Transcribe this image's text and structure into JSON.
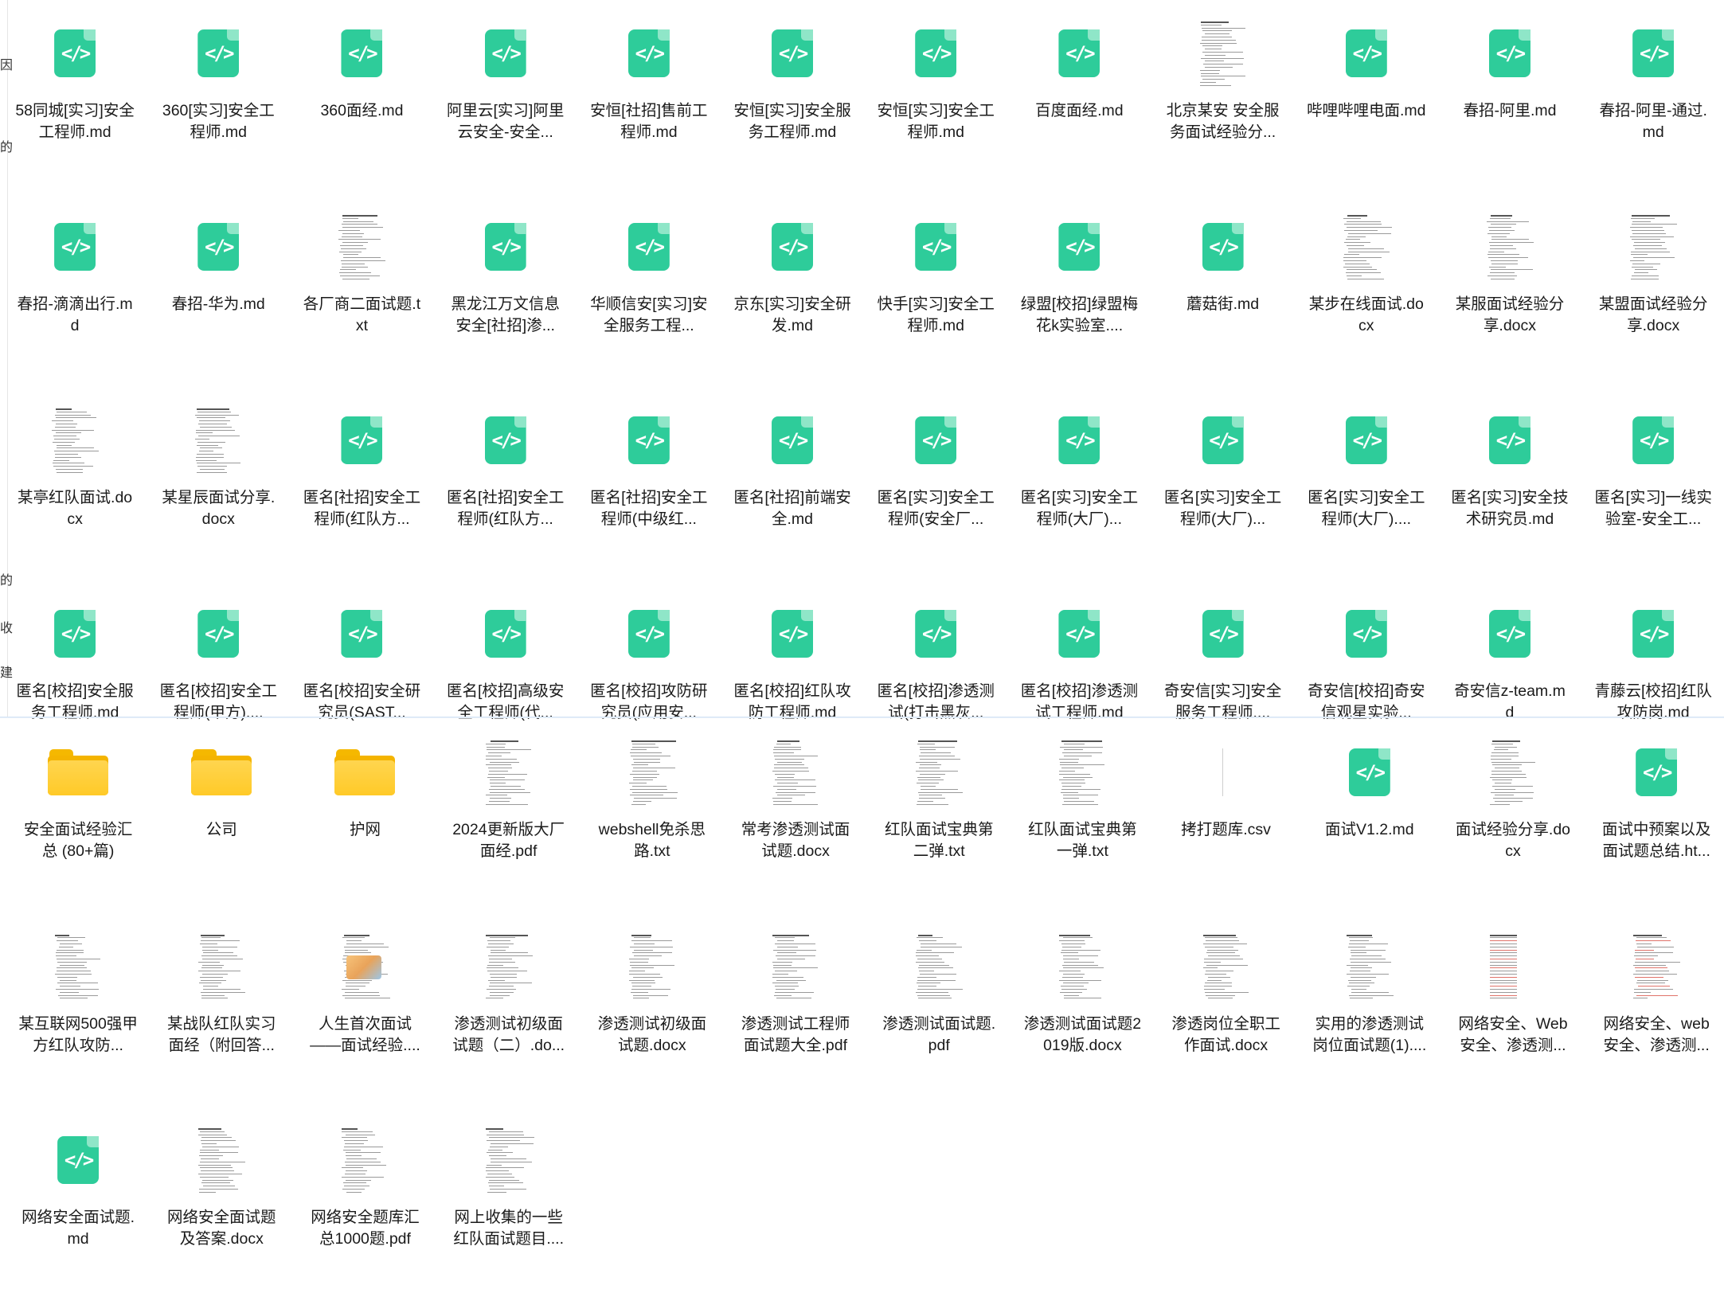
{
  "colors": {
    "code_icon": "#2ecc9a",
    "folder": "#ffca28",
    "text": "#1a1a1a"
  },
  "left_strip": [
    "因",
    "的",
    "的",
    "收",
    "建"
  ],
  "top_items": [
    {
      "label": "58同城[实习]安全工程师.md",
      "icon": "code-icon"
    },
    {
      "label": "360[实习]安全工程师.md",
      "icon": "code-icon"
    },
    {
      "label": "360面经.md",
      "icon": "code-icon"
    },
    {
      "label": "阿里云[实习]阿里云安全-安全...",
      "icon": "code-icon"
    },
    {
      "label": "安恒[社招]售前工程师.md",
      "icon": "code-icon"
    },
    {
      "label": "安恒[实习]安全服务工程师.md",
      "icon": "code-icon"
    },
    {
      "label": "安恒[实习]安全工程师.md",
      "icon": "code-icon"
    },
    {
      "label": "百度面经.md",
      "icon": "code-icon"
    },
    {
      "label": "北京某安 安全服务面试经验分...",
      "icon": "document-thumbnail"
    },
    {
      "label": "哔哩哔哩电面.md",
      "icon": "code-icon"
    },
    {
      "label": "春招-阿里.md",
      "icon": "code-icon"
    },
    {
      "label": "春招-阿里-通过.md",
      "icon": "code-icon"
    },
    {
      "label": "春招-滴滴出行.md",
      "icon": "code-icon"
    },
    {
      "label": "春招-华为.md",
      "icon": "code-icon"
    },
    {
      "label": "各厂商二面试题.txt",
      "icon": "document-thumbnail"
    },
    {
      "label": "黑龙江万文信息安全[社招]渗...",
      "icon": "code-icon"
    },
    {
      "label": "华顺信安[实习]安全服务工程...",
      "icon": "code-icon"
    },
    {
      "label": "京东[实习]安全研发.md",
      "icon": "code-icon"
    },
    {
      "label": "快手[实习]安全工程师.md",
      "icon": "code-icon"
    },
    {
      "label": "绿盟[校招]绿盟梅花k实验室....",
      "icon": "code-icon"
    },
    {
      "label": "蘑菇街.md",
      "icon": "code-icon"
    },
    {
      "label": "某步在线面试.docx",
      "icon": "document-thumbnail"
    },
    {
      "label": "某服面试经验分享.docx",
      "icon": "document-thumbnail"
    },
    {
      "label": "某盟面试经验分享.docx",
      "icon": "document-thumbnail"
    },
    {
      "label": "某亭红队面试.docx",
      "icon": "document-thumbnail"
    },
    {
      "label": "某星辰面试分享.docx",
      "icon": "document-thumbnail"
    },
    {
      "label": "匿名[社招]安全工程师(红队方...",
      "icon": "code-icon"
    },
    {
      "label": "匿名[社招]安全工程师(红队方...",
      "icon": "code-icon"
    },
    {
      "label": "匿名[社招]安全工程师(中级红...",
      "icon": "code-icon"
    },
    {
      "label": "匿名[社招]前端安全.md",
      "icon": "code-icon"
    },
    {
      "label": "匿名[实习]安全工程师(安全厂...",
      "icon": "code-icon"
    },
    {
      "label": "匿名[实习]安全工程师(大厂)...",
      "icon": "code-icon"
    },
    {
      "label": "匿名[实习]安全工程师(大厂)...",
      "icon": "code-icon"
    },
    {
      "label": "匿名[实习]安全工程师(大厂)....",
      "icon": "code-icon"
    },
    {
      "label": "匿名[实习]安全技术研究员.md",
      "icon": "code-icon"
    },
    {
      "label": "匿名[实习]一线实验室-安全工...",
      "icon": "code-icon"
    },
    {
      "label": "匿名[校招]安全服务工程师.md",
      "icon": "code-icon"
    },
    {
      "label": "匿名[校招]安全工程师(甲方)....",
      "icon": "code-icon"
    },
    {
      "label": "匿名[校招]安全研究员(SAST...",
      "icon": "code-icon"
    },
    {
      "label": "匿名[校招]高级安全工程师(代...",
      "icon": "code-icon"
    },
    {
      "label": "匿名[校招]攻防研究员(应用安...",
      "icon": "code-icon"
    },
    {
      "label": "匿名[校招]红队攻防工程师.md",
      "icon": "code-icon"
    },
    {
      "label": "匿名[校招]渗透测试(打击黑灰...",
      "icon": "code-icon"
    },
    {
      "label": "匿名[校招]渗透测试工程师.md",
      "icon": "code-icon"
    },
    {
      "label": "奇安信[实习]安全服务工程师....",
      "icon": "code-icon"
    },
    {
      "label": "奇安信[校招]奇安信观星实验...",
      "icon": "code-icon"
    },
    {
      "label": "奇安信z-team.md",
      "icon": "code-icon"
    },
    {
      "label": "青藤云[校招]红队攻防岗.md",
      "icon": "code-icon"
    }
  ],
  "bottom_items": [
    {
      "label": "安全面试经验汇总 (80+篇)",
      "icon": "folder-icon"
    },
    {
      "label": "公司",
      "icon": "folder-icon"
    },
    {
      "label": "护网",
      "icon": "folder-icon"
    },
    {
      "label": "2024更新版大厂面经.pdf",
      "icon": "document-thumbnail"
    },
    {
      "label": "webshell免杀思路.txt",
      "icon": "document-thumbnail"
    },
    {
      "label": "常考渗透测试面试题.docx",
      "icon": "document-thumbnail"
    },
    {
      "label": "红队面试宝典第二弹.txt",
      "icon": "document-thumbnail"
    },
    {
      "label": "红队面试宝典第一弹.txt",
      "icon": "document-thumbnail"
    },
    {
      "label": "拷打题库.csv",
      "icon": "blank-thumbnail"
    },
    {
      "label": "面试V1.2.md",
      "icon": "code-icon"
    },
    {
      "label": "面试经验分享.docx",
      "icon": "document-thumbnail"
    },
    {
      "label": "面试中预案以及面试题总结.ht...",
      "icon": "code-icon"
    },
    {
      "label": "某互联网500强甲方红队攻防...",
      "icon": "document-thumbnail"
    },
    {
      "label": "某战队红队实习面经（附回答...",
      "icon": "document-thumbnail"
    },
    {
      "label": "人生首次面试——面试经验....",
      "icon": "picture-thumbnail"
    },
    {
      "label": "渗透测试初级面试题（二）.do...",
      "icon": "document-thumbnail"
    },
    {
      "label": "渗透测试初级面试题.docx",
      "icon": "document-thumbnail"
    },
    {
      "label": "渗透测试工程师面试题大全.pdf",
      "icon": "document-thumbnail"
    },
    {
      "label": "渗透测试面试题.pdf",
      "icon": "document-thumbnail"
    },
    {
      "label": "渗透测试面试题2019版.docx",
      "icon": "document-thumbnail"
    },
    {
      "label": "渗透岗位全职工作面试.docx",
      "icon": "document-thumbnail"
    },
    {
      "label": "实用的渗透测试岗位面试题(1)....",
      "icon": "document-thumbnail"
    },
    {
      "label": "网络安全、Web安全、渗透测...",
      "icon": "document-thumbnail-red"
    },
    {
      "label": "网络安全、web安全、渗透测...",
      "icon": "document-thumbnail-red"
    },
    {
      "label": "网络安全面试题.md",
      "icon": "code-icon"
    },
    {
      "label": "网络安全面试题及答案.docx",
      "icon": "document-thumbnail"
    },
    {
      "label": "网络安全题库汇总1000题.pdf",
      "icon": "document-thumbnail"
    },
    {
      "label": "网上收集的一些红队面试题目....",
      "icon": "document-thumbnail"
    }
  ]
}
